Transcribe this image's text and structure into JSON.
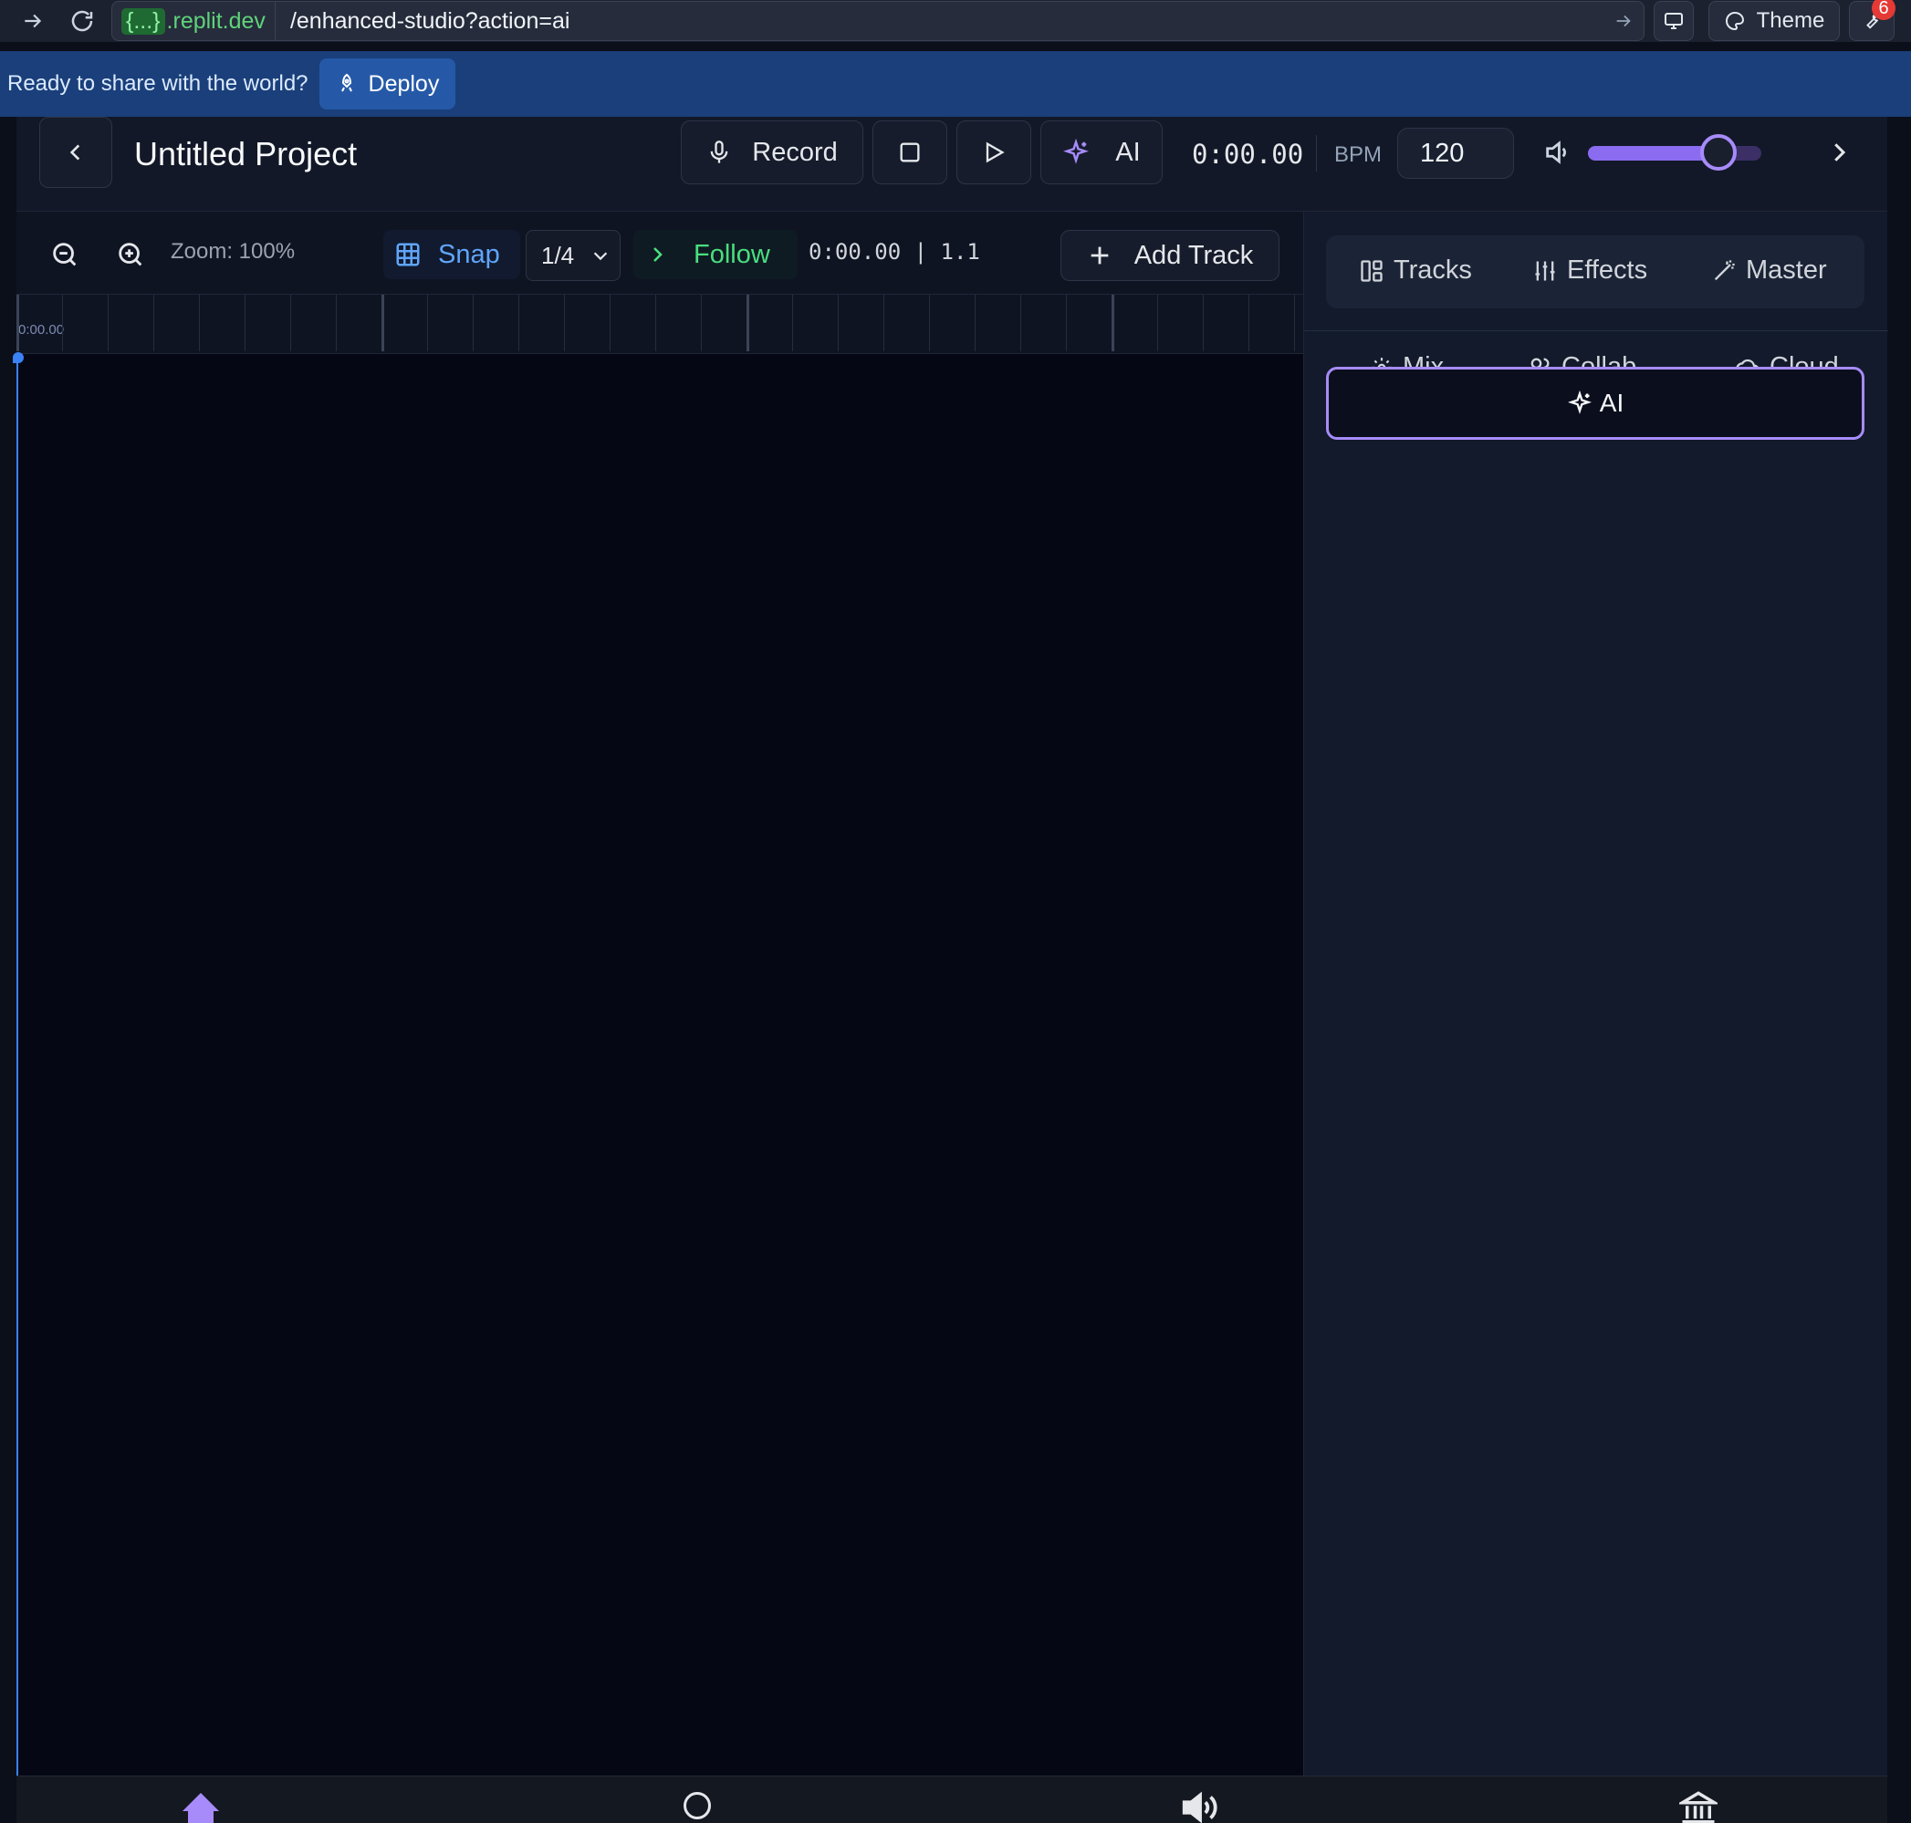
{
  "browser": {
    "domain_prefix": "{...}",
    "domain": ".replit.dev",
    "path": "/enhanced-studio?action=ai",
    "theme_label": "Theme",
    "notification_count": "6"
  },
  "banner": {
    "text": "Ready to share with the world?",
    "deploy_label": "Deploy"
  },
  "header": {
    "project_title": "Untitled Project",
    "record_label": "Record",
    "ai_label": "AI",
    "time": "0:00.00",
    "bpm_label": "BPM",
    "bpm_value": "120",
    "volume_level": 0.75
  },
  "timeline_toolbar": {
    "zoom_label": "Zoom: 100%",
    "snap_label": "Snap",
    "snap_division": "1/4",
    "follow_label": "Follow",
    "position": "0:00.00 | 1.1",
    "add_track_label": "Add Track"
  },
  "ruler": {
    "start_label": "0:00.00"
  },
  "panel": {
    "tabs": [
      {
        "label": "Tracks",
        "icon": "layout-icon"
      },
      {
        "label": "Effects",
        "icon": "sliders-icon"
      },
      {
        "label": "Master",
        "icon": "magic-wand-icon"
      },
      {
        "label": "Mix",
        "icon": "gear-icon"
      },
      {
        "label": "Collab",
        "icon": "users-icon"
      },
      {
        "label": "Cloud",
        "icon": "cloud-icon"
      },
      {
        "label": "AI",
        "icon": "sparkles-icon"
      }
    ],
    "active_tab": "AI"
  },
  "colors": {
    "accent": "#a78bfa",
    "snap": "#60a5fa",
    "follow": "#4ade80",
    "playhead": "#3b82f6",
    "banner": "#1a3f7a"
  }
}
